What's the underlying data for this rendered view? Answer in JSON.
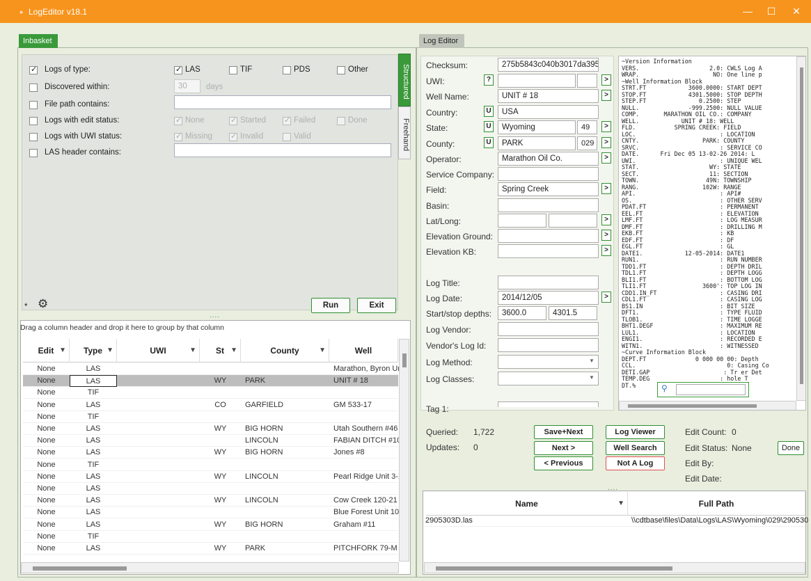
{
  "app": {
    "title": "LogEditor  v18.1",
    "logo": "»"
  },
  "window": {
    "minimize": "—",
    "maximize": "☐",
    "close": "✕"
  },
  "tabs": {
    "inbasket": "Inbasket",
    "logeditor": "Log Editor"
  },
  "side_tabs": {
    "structured": "Structured",
    "freehand": "Freehand"
  },
  "filters": {
    "logs_of_type": {
      "label": "Logs of type:",
      "checked": true,
      "options": [
        {
          "label": "LAS",
          "checked": true
        },
        {
          "label": "TIF",
          "checked": false
        },
        {
          "label": "PDS",
          "checked": false
        },
        {
          "label": "Other",
          "checked": false
        }
      ]
    },
    "discovered": {
      "label": "Discovered within:",
      "value": "30",
      "unit": "days"
    },
    "file_path": {
      "label": "File path contains:"
    },
    "edit_status": {
      "label": "Logs with edit status:",
      "options": [
        {
          "label": "None",
          "checked": true
        },
        {
          "label": "Started",
          "checked": true
        },
        {
          "label": "Failed",
          "checked": true
        },
        {
          "label": "Done",
          "checked": false
        }
      ]
    },
    "uwi_status": {
      "label": "Logs with UWI status:",
      "options": [
        {
          "label": "Missing",
          "checked": true
        },
        {
          "label": "Invalid",
          "checked": true
        },
        {
          "label": "Valid",
          "checked": false
        }
      ]
    },
    "las_header": {
      "label": "LAS header contains:"
    }
  },
  "buttons": {
    "run": "Run",
    "exit": "Exit"
  },
  "misc": {
    "asterisk": "*",
    "dots": "....",
    "gear": "⚙"
  },
  "grid": {
    "group_hint": "Drag a column header and drop it here to group by that column",
    "columns": [
      "Edit",
      "Type",
      "UWI",
      "St",
      "County",
      "Well"
    ],
    "rows": [
      [
        "None",
        "LAS",
        "",
        "",
        "",
        "Marathon, Byron Un"
      ],
      [
        "None",
        "LAS",
        "",
        "WY",
        "PARK",
        "UNIT # 18"
      ],
      [
        "None",
        "TIF",
        "",
        "",
        "",
        ""
      ],
      [
        "None",
        "LAS",
        "",
        "CO",
        "GARFIELD",
        "GM 533-17"
      ],
      [
        "None",
        "TIF",
        "",
        "",
        "",
        ""
      ],
      [
        "None",
        "LAS",
        "",
        "WY",
        "BIG HORN",
        "Utah Southern #46"
      ],
      [
        "None",
        "LAS",
        "",
        "",
        "LINCOLN",
        "FABIAN DITCH #10-."
      ],
      [
        "None",
        "LAS",
        "",
        "WY",
        "BIG HORN",
        "Jones #8"
      ],
      [
        "None",
        "TIF",
        "",
        "",
        "",
        ""
      ],
      [
        "None",
        "LAS",
        "",
        "WY",
        "LINCOLN",
        "Pearl Ridge Unit 3-1"
      ],
      [
        "None",
        "LAS",
        "",
        "",
        "",
        ""
      ],
      [
        "None",
        "LAS",
        "",
        "WY",
        "LINCOLN",
        "Cow Creek 120-21"
      ],
      [
        "None",
        "LAS",
        "",
        "",
        "",
        "Blue Forest Unit 10-"
      ],
      [
        "None",
        "LAS",
        "",
        "WY",
        "BIG HORN",
        "Graham #11"
      ],
      [
        "None",
        "TIF",
        "",
        "",
        "",
        ""
      ],
      [
        "None",
        "LAS",
        "",
        "WY",
        "PARK",
        "PITCHFORK 79-M"
      ]
    ]
  },
  "editor": {
    "checksum": {
      "label": "Checksum:",
      "value": "275b5843c040b3017da3952"
    },
    "uwi": {
      "label": "UWI:",
      "value": ""
    },
    "well_name": {
      "label": "Well Name:",
      "value": "UNIT # 18"
    },
    "country": {
      "label": "Country:",
      "value": "USA"
    },
    "state": {
      "label": "State:",
      "value": "Wyoming",
      "code": "49"
    },
    "county": {
      "label": "County:",
      "value": "PARK",
      "code": "029"
    },
    "operator": {
      "label": "Operator:",
      "value": "Marathon Oil Co."
    },
    "service_company": {
      "label": "Service Company:",
      "value": ""
    },
    "field": {
      "label": "Field:",
      "value": "Spring Creek"
    },
    "basin": {
      "label": "Basin:",
      "value": ""
    },
    "latlong": {
      "label": "Lat/Long:",
      "value": ""
    },
    "elev_ground": {
      "label": "Elevation Ground:",
      "value": ""
    },
    "elev_kb": {
      "label": "Elevation KB:",
      "value": ""
    },
    "log_title": {
      "label": "Log Title:",
      "value": ""
    },
    "log_date": {
      "label": "Log Date:",
      "value": "2014/12/05"
    },
    "depths": {
      "label": "Start/stop depths:",
      "start": "3600.0",
      "stop": "4301.5"
    },
    "log_vendor": {
      "label": "Log Vendor:",
      "value": ""
    },
    "vendor_log_id": {
      "label": "Vendor's Log Id:",
      "value": ""
    },
    "log_method": {
      "label": "Log Method:",
      "value": ""
    },
    "log_classes": {
      "label": "Log Classes:",
      "value": ""
    },
    "tag1": {
      "label": "Tag 1:",
      "value": ""
    },
    "btn_q": "?",
    "btn_u": "U",
    "btn_arrow": ">"
  },
  "las_header_text": "~Version Information\nVERS.                    2.0: CWLS Log A\nWRAP.                     NO: One line p\n~Well Information Block\nSTRT.FT            3600.0000: START DEPT\nSTOP.FT            4301.5000: STOP DEPTH\nSTEP.FT               0.2500: STEP\nNULL.              -999.2500: NULL VALUE\nCOMP.       MARATHON OIL CO.: COMPANY\nWELL.            UNIT # 18: WELL\nFLD.           SPRING CREEK: FIELD\nLOC.                        : LOCATION\nCNTY.                  PARK: COUNTY\nSRVC.                       : SERVICE CO\nDATE.      Fri Dec 05 13-02-26 2014: L\nUWI.                        : UNIQUE WEL\nSTAT.                    WY: STATE\nSECT.                    11: SECTION\nTOWN.                   49N: TOWNSHIP\nRANG.                  102W: RANGE\nAPI.                        : API#\nOS.                         : OTHER SERV\nPDAT.FT                     : PERMANENT\nEEL.FT                      : ELEVATION\nLMF.FT                      : LOG MEASUR\nDMF.FT                      : DRILLING M\nEKB.FT                      : KB\nEDF.FT                      : DF\nEGL.FT                      : GL\nDATE1.            12-05-2014: DATE1\nRUN1.                       : RUN NUMBER\nTDD1.FT                     : DEPTH DRIL\nTDL1.FT                     : DEPTH LOGG\nBLI1.FT                     : BOTTOM LOG\nTLI1.FT                3600': TOP LOG IN\nCDD1.IN_FT                  : CASING DRI\nCDL1.FT                     : CASING LOG\nBS1.IN                      : BIT SIZE\nDFT1.                       : TYPE FLUID\nTLOB1.                      : TIME LOGGE\nBHT1.DEGF                   : MAXIMUM RE\nLUL1.                       : LOCATION\nENGI1.                      : RECORDED E\nWITN1.                      : WITNESSED\n~Curve Information Block\nDEPT.FT              0 000 00 00: Depth\nCCL.                          0: Casing Co\nDETI.GAP                     : Tr er Det\nTEMP.DEG                    : hole T\nDT.%                        : a Curv",
  "status": {
    "queried_label": "Queried:",
    "queried": "1,722",
    "updates_label": "Updates:",
    "updates": "0",
    "edit_count_label": "Edit Count:",
    "edit_count": "0",
    "edit_status_label": "Edit Status:",
    "edit_status": "None",
    "edit_by_label": "Edit By:",
    "edit_date_label": "Edit Date:"
  },
  "nav_buttons": {
    "save_next": "Save+Next",
    "next": "Next >",
    "previous": "< Previous",
    "log_viewer": "Log Viewer",
    "well_search": "Well Search",
    "not_a_log": "Not A Log",
    "done": "Done"
  },
  "files": {
    "columns": [
      "Name",
      "Full Path"
    ],
    "rows": [
      [
        "2905303D.las",
        "\\\\cdtbase\\files\\Data\\Logs\\LAS\\Wyoming\\029\\290530"
      ]
    ]
  },
  "colors": {
    "titlebar": "#f7941d",
    "accent": "#3a9a3a",
    "danger": "#e05050"
  }
}
